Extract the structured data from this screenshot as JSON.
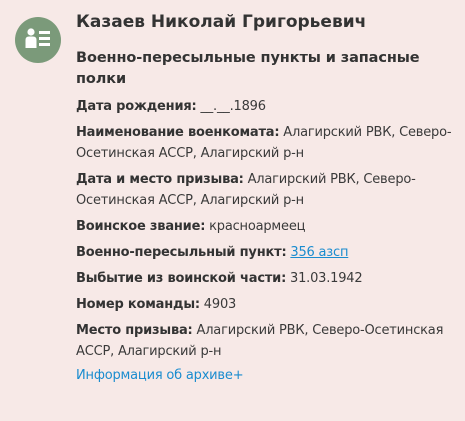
{
  "person": {
    "name": "Казаев Николай Григорьевич",
    "category": "Военно-пересыльные пункты и запасные полки",
    "icon": "soldier-list-icon"
  },
  "fields": {
    "birth_date": {
      "label": "Дата рождения:",
      "value": " __.__.1896"
    },
    "commissariat": {
      "label": "Наименование военкомата:",
      "value": " Алагирский РВК, Северо-Осетинская АССР, Алагирский р-н"
    },
    "conscription": {
      "label": "Дата и место призыва:",
      "value": " Алагирский РВК, Северо-Осетинская АССР, Алагирский р-н"
    },
    "rank": {
      "label": "Воинское звание:",
      "value": " красноармеец"
    },
    "transit_point": {
      "label": "Военно-пересыльный пункт:",
      "value": "356 азсп"
    },
    "departure": {
      "label": "Выбытие из воинской части:",
      "value": " 31.03.1942"
    },
    "team_number": {
      "label": "Номер команды:",
      "value": " 4903"
    },
    "place": {
      "label": "Место призыва:",
      "value": " Алагирский РВК, Северо-Осетинская АССР, Алагирский р-н"
    }
  },
  "archive_link": "Информация об архиве+",
  "colors": {
    "background": "#f7e9e7",
    "avatar": "#7b9a7a",
    "link": "#1a8ccf"
  }
}
